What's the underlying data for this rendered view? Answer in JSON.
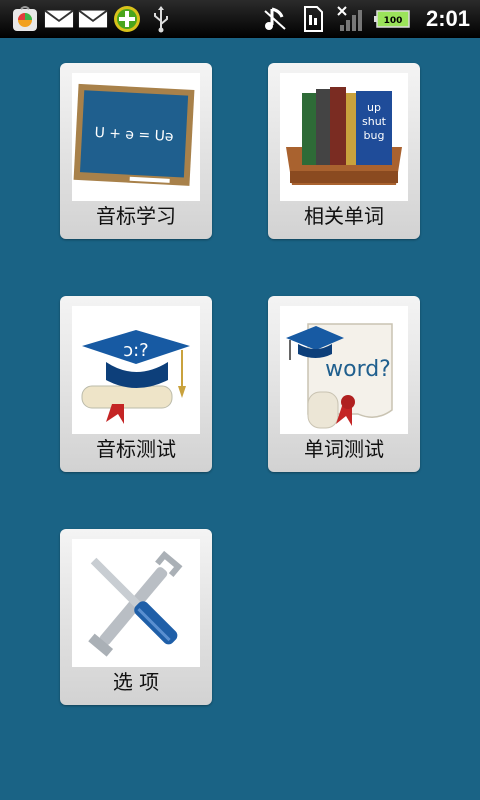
{
  "status_bar": {
    "time": "2:01",
    "battery_level": "100",
    "left_icons": [
      "app-store-icon",
      "mail-icon",
      "mail-icon",
      "plus-badge-icon",
      "usb-icon"
    ],
    "right_icons": [
      "music-off-icon",
      "sim-card-icon",
      "no-signal-icon",
      "battery-icon"
    ]
  },
  "menu": {
    "items": [
      {
        "label": "音标学习",
        "icon": "blackboard-icon"
      },
      {
        "label": "相关单词",
        "icon": "books-icon"
      },
      {
        "label": "音标测试",
        "icon": "graduation-cap-icon"
      },
      {
        "label": "单词测试",
        "icon": "word-scroll-icon"
      },
      {
        "label": "选 项",
        "icon": "tools-icon"
      }
    ],
    "art_text": {
      "board": "U + ə = Uə",
      "book_spine_1": "up",
      "book_spine_2": "shut",
      "book_spine_3": "bug",
      "cap_text": "ɔ:?",
      "scroll_text": "word?"
    }
  },
  "colors": {
    "background": "#1a6385",
    "tile": "#e6e6e6",
    "status_bar": "#000000"
  }
}
